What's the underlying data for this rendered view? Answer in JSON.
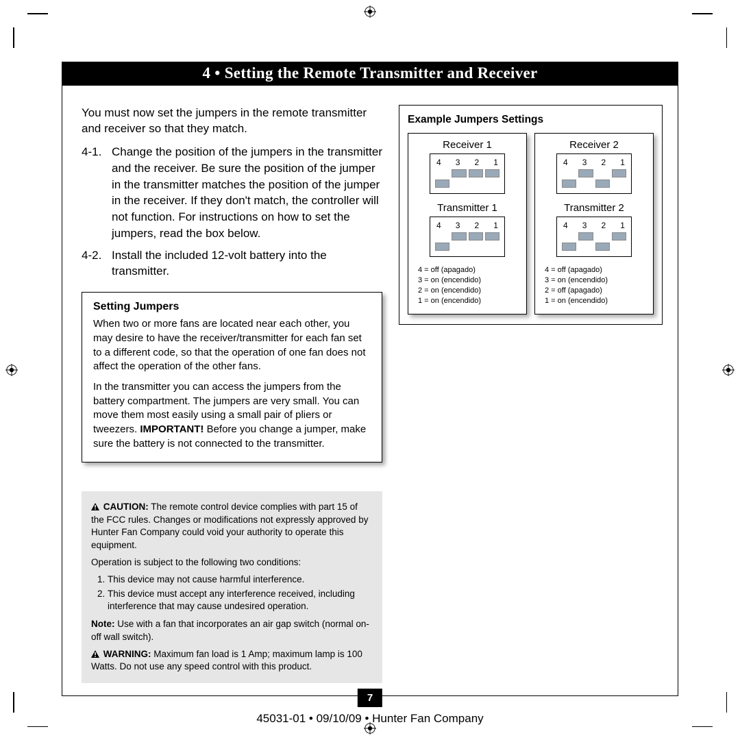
{
  "header": {
    "title": "4 • Setting the Remote Transmitter and Receiver"
  },
  "intro": "You must now set the jumpers in the remote transmitter and receiver so that they match.",
  "steps": [
    {
      "num": "4-1.",
      "body": "Change the position of the jumpers in the transmitter and the receiver. Be sure the position of the jumper in the transmitter matches the position of the jumper in the receiver. If they don't match, the controller will not function. For instructions on how to set the jumpers, read the box below."
    },
    {
      "num": "4-2.",
      "body": "Install the included 12-volt battery into the transmitter."
    }
  ],
  "infobox": {
    "heading": "Setting Jumpers",
    "p1": "When two or more fans are located near each other, you may desire to have the receiver/transmitter for each fan set to a different code, so that the operation of one fan does not affect the operation of the other fans.",
    "p2a": "In the transmitter you can access the jumpers from the battery compartment. The jumpers are very small. You can move them most easily using a small pair of pliers or tweezers. ",
    "important": "IMPORTANT!",
    "p2b": " Before you change  a jumper, make sure the battery is not connected to the transmitter."
  },
  "gray": {
    "caution_label": "CAUTION:",
    "caution_body": " The remote control device complies with part 15 of the FCC rules. Changes or modifications not expressly approved by Hunter Fan Company could void your authority to operate this equipment.",
    "op_line": "Operation is subject to the following two conditions:",
    "cond1": "This device may not cause harmful interference.",
    "cond2": "This device must accept any interference received, including interference that may cause undesired operation.",
    "note_label": "Note:",
    "note_body": " Use with a fan that incorporates an air gap switch (normal on-off wall switch).",
    "warn_label": "WARNING:",
    "warn_body": " Maximum fan load is 1 Amp; maximum lamp is 100 Watts. Do not use any speed control with this product."
  },
  "example": {
    "title": "Example Jumpers Settings",
    "sets": [
      {
        "rx_label": "Receiver 1",
        "tx_label": "Transmitter 1",
        "nums": [
          "4",
          "3",
          "2",
          "1"
        ],
        "pattern": [
          [
            "off",
            "on"
          ],
          [
            "on",
            "off"
          ],
          [
            "on",
            "off"
          ],
          [
            "on",
            "off"
          ]
        ],
        "legend": [
          "4 = off (apagado)",
          "3 = on (encendido)",
          "2 = on (encendido)",
          "1 = on (encendido)"
        ]
      },
      {
        "rx_label": "Receiver 2",
        "tx_label": "Transmitter 2",
        "nums": [
          "4",
          "3",
          "2",
          "1"
        ],
        "pattern": [
          [
            "off",
            "on"
          ],
          [
            "on",
            "off"
          ],
          [
            "off",
            "on"
          ],
          [
            "on",
            "off"
          ]
        ],
        "legend": [
          "4 = off (apagado)",
          "3 = on (encendido)",
          "2 = off (apagado)",
          "1 = on (encendido)"
        ]
      }
    ]
  },
  "page_num": "7",
  "footer": "45031-01  •  09/10/09  •  Hunter Fan Company"
}
